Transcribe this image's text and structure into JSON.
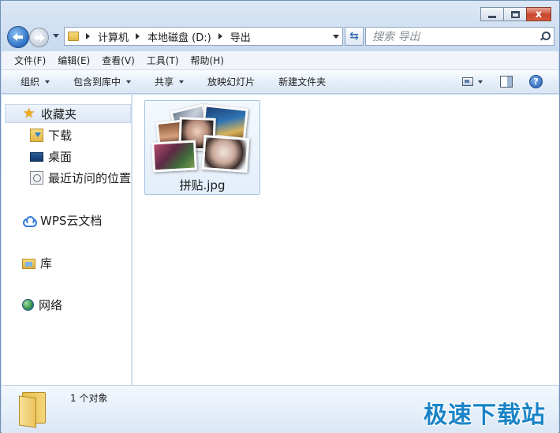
{
  "window": {
    "close_glyph": "x"
  },
  "address_bar": {
    "crumbs": [
      "计算机",
      "本地磁盘 (D:)",
      "导出"
    ]
  },
  "search": {
    "placeholder": "搜索 导出"
  },
  "menubar": {
    "items": [
      "文件(F)",
      "编辑(E)",
      "查看(V)",
      "工具(T)",
      "帮助(H)"
    ]
  },
  "command_bar": {
    "organize": "组织",
    "include_in_library": "包含到库中",
    "share": "共享",
    "slideshow": "放映幻灯片",
    "new_folder": "新建文件夹",
    "help_glyph": "?"
  },
  "nav_pane": {
    "favorites": "收藏夹",
    "downloads": "下载",
    "desktop": "桌面",
    "recent_places": "最近访问的位置",
    "wps_cloud": "WPS云文档",
    "libraries": "库",
    "network": "网络"
  },
  "files": [
    {
      "name": "拼贴.jpg",
      "icon": "image-collage-thumbnail"
    }
  ],
  "details_pane": {
    "count_text": "1 个对象"
  },
  "watermark": {
    "text": "极速下载站"
  },
  "colors": {
    "accent": "#1a84c8",
    "close_button": "#c9462c",
    "selection": "#dde8f5"
  }
}
